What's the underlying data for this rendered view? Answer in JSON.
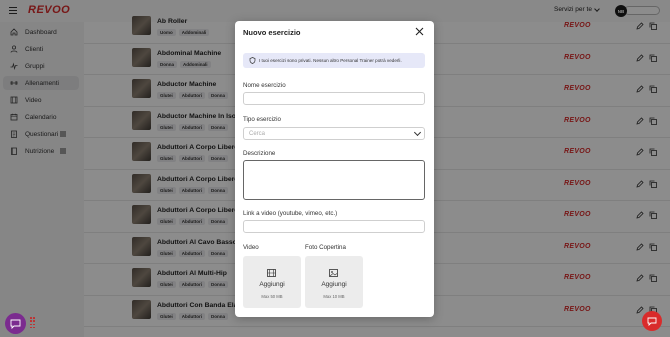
{
  "header": {
    "logo": "REVOO",
    "services_label": "Servizi per te",
    "avatar_initials": "NB"
  },
  "sidebar": {
    "items": [
      {
        "label": "Dashboard",
        "icon": "home-icon"
      },
      {
        "label": "Clienti",
        "icon": "user-icon"
      },
      {
        "label": "Gruppi",
        "icon": "activity-icon"
      },
      {
        "label": "Allenamenti",
        "icon": "dumbbell-icon",
        "active": true
      },
      {
        "label": "Video",
        "icon": "film-icon"
      },
      {
        "label": "Calendario",
        "icon": "calendar-icon"
      },
      {
        "label": "Questionari",
        "icon": "clipboard-icon"
      },
      {
        "label": "Nutrizione",
        "icon": "book-icon"
      }
    ]
  },
  "exercises": [
    {
      "title": "Ab Roller",
      "tags": [
        "Uomo",
        "Addominali"
      ],
      "brand": "REVOO"
    },
    {
      "title": "Abdominal Machine",
      "tags": [
        "Donna",
        "Addominali"
      ],
      "brand": "REVOO"
    },
    {
      "title": "Abductor Machine",
      "tags": [
        "Glutei",
        "Abduttori",
        "Donna"
      ],
      "brand": "REVOO"
    },
    {
      "title": "Abductor Machine In Isometria",
      "tags": [
        "Glutei",
        "Abduttori",
        "Donna"
      ],
      "brand": "REVOO"
    },
    {
      "title": "Abduttori A Corpo Libero",
      "tags": [
        "Glutei",
        "Abduttori",
        "Donna"
      ],
      "brand": "REVOO"
    },
    {
      "title": "Abduttori A Corpo Libero",
      "tags": [
        "Glutei",
        "Abduttori",
        "Donna"
      ],
      "brand": "REVOO"
    },
    {
      "title": "Abduttori A Corpo Libero",
      "tags": [
        "Glutei",
        "Abduttori",
        "Donna"
      ],
      "brand": "REVOO"
    },
    {
      "title": "Abduttori Al Cavo Basso",
      "tags": [
        "Glutei",
        "Abduttori",
        "Donna"
      ],
      "brand": "REVOO"
    },
    {
      "title": "Abduttori Al Multi-Hip",
      "tags": [
        "Glutei",
        "Abduttori",
        "Donna"
      ],
      "brand": "REVOO"
    },
    {
      "title": "Abduttori Con Banda Elastica",
      "tags": [
        "Glutei",
        "Abduttori",
        "Donna"
      ],
      "brand": "REVOO"
    }
  ],
  "modal": {
    "title": "Nuovo esercizio",
    "info_text": "I tuoi esercizi sono privati. Nessun altro Personal Trainer potrà vederli.",
    "name_label": "Nome esercizio",
    "name_value": "",
    "type_label": "Tipo esercizio",
    "type_placeholder": "Cerca",
    "description_label": "Descrizione",
    "description_value": "",
    "link_label": "Link a video (youtube, vimeo, etc.)",
    "link_value": "",
    "video_label": "Video",
    "cover_label": "Foto Copertina",
    "video_upload": {
      "label": "Aggiungi",
      "max": "Max 50 MB"
    },
    "cover_upload": {
      "label": "Aggiungi",
      "max": "Max 10 MB"
    }
  },
  "colors": {
    "brand_red": "#d92b2b",
    "info_bg": "#e6e8f8",
    "chat_purple": "#7b2b8f"
  }
}
